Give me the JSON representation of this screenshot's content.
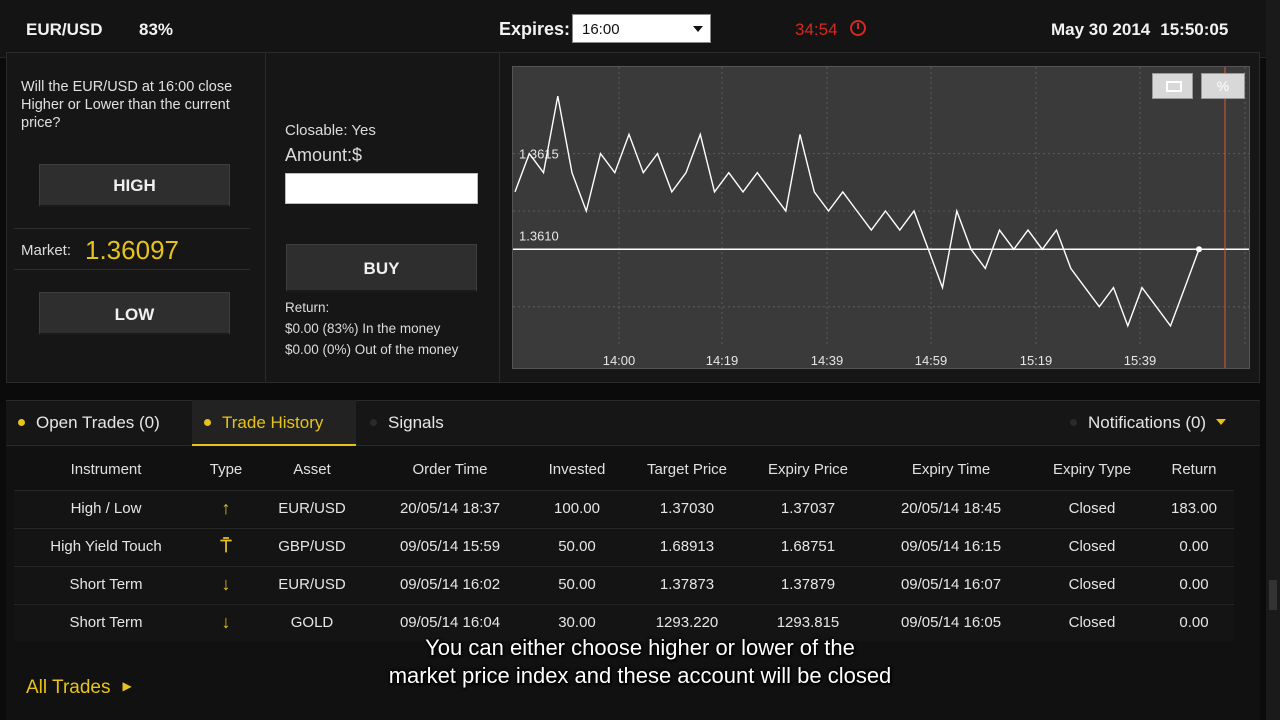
{
  "header": {
    "pair": "EUR/USD",
    "payout": "83%",
    "expires_label": "Expires:",
    "expires_value": "16:00",
    "countdown": "34:54",
    "date": "May 30 2014",
    "time": "15:50:05"
  },
  "trade_panel": {
    "question": "Will the EUR/USD at 16:00 close Higher or Lower than the current price?",
    "high_label": "HIGH",
    "low_label": "LOW",
    "market_label": "Market:",
    "market_value": "1.36097",
    "closable": "Closable: Yes",
    "amount_label": "Amount:$",
    "amount_value": "",
    "buy_label": "BUY",
    "return_label": "Return:",
    "return_in": "$0.00 (83%) In the money",
    "return_out": "$0.00 (0%) Out of the money"
  },
  "chart_data": {
    "type": "line",
    "x_ticks": [
      "14:00",
      "14:19",
      "14:39",
      "14:59",
      "15:19",
      "15:39"
    ],
    "y_ticks": [
      "1.3615",
      "1.3610"
    ],
    "strike_value": 1.361,
    "buttons": [
      "window-icon",
      "%"
    ],
    "grid": true,
    "series": [
      {
        "values": [
          1.3613,
          1.3615,
          1.3614,
          1.3618,
          1.3614,
          1.3612,
          1.3615,
          1.3614,
          1.3616,
          1.3614,
          1.3615,
          1.3613,
          1.3614,
          1.3616,
          1.3613,
          1.3614,
          1.3613,
          1.3614,
          1.3613,
          1.3612,
          1.3616,
          1.3613,
          1.3612,
          1.3613,
          1.3612,
          1.3611,
          1.3612,
          1.3611,
          1.3612,
          1.361,
          1.3608,
          1.3612,
          1.361,
          1.3609,
          1.3611,
          1.361,
          1.3611,
          1.361,
          1.3611,
          1.3609,
          1.3608,
          1.3607,
          1.3608,
          1.3606,
          1.3608,
          1.3607,
          1.3606,
          1.3608,
          1.361
        ],
        "colors": {
          "line": "#ffffff",
          "strike": "#ffffff",
          "marker": "#e05a2a"
        }
      }
    ]
  },
  "tabs": {
    "open_trades": "Open Trades (0)",
    "trade_history": "Trade History",
    "signals": "Signals",
    "notifications": "Notifications (0)"
  },
  "table": {
    "headers": [
      "Instrument",
      "Type",
      "Asset",
      "Order Time",
      "Invested",
      "Target Price",
      "Expiry Price",
      "Expiry Time",
      "Expiry Type",
      "Return"
    ],
    "rows": [
      [
        "High / Low",
        "↑",
        "EUR/USD",
        "20/05/14 18:37",
        "100.00",
        "1.37030",
        "1.37037",
        "20/05/14 18:45",
        "Closed",
        "183.00"
      ],
      [
        "High Yield Touch",
        "⍑",
        "GBP/USD",
        "09/05/14 15:59",
        "50.00",
        "1.68913",
        "1.68751",
        "09/05/14 16:15",
        "Closed",
        "0.00"
      ],
      [
        "Short Term",
        "↓",
        "EUR/USD",
        "09/05/14 16:02",
        "50.00",
        "1.37873",
        "1.37879",
        "09/05/14 16:07",
        "Closed",
        "0.00"
      ],
      [
        "Short Term",
        "↓",
        "GOLD",
        "09/05/14 16:04",
        "30.00",
        "1293.220",
        "1293.815",
        "09/05/14 16:05",
        "Closed",
        "0.00"
      ]
    ]
  },
  "footer": {
    "all_trades": "All Trades",
    "subtitle_line1": "You can either choose higher or lower of the",
    "subtitle_line2": "market price index and these account will be closed"
  }
}
